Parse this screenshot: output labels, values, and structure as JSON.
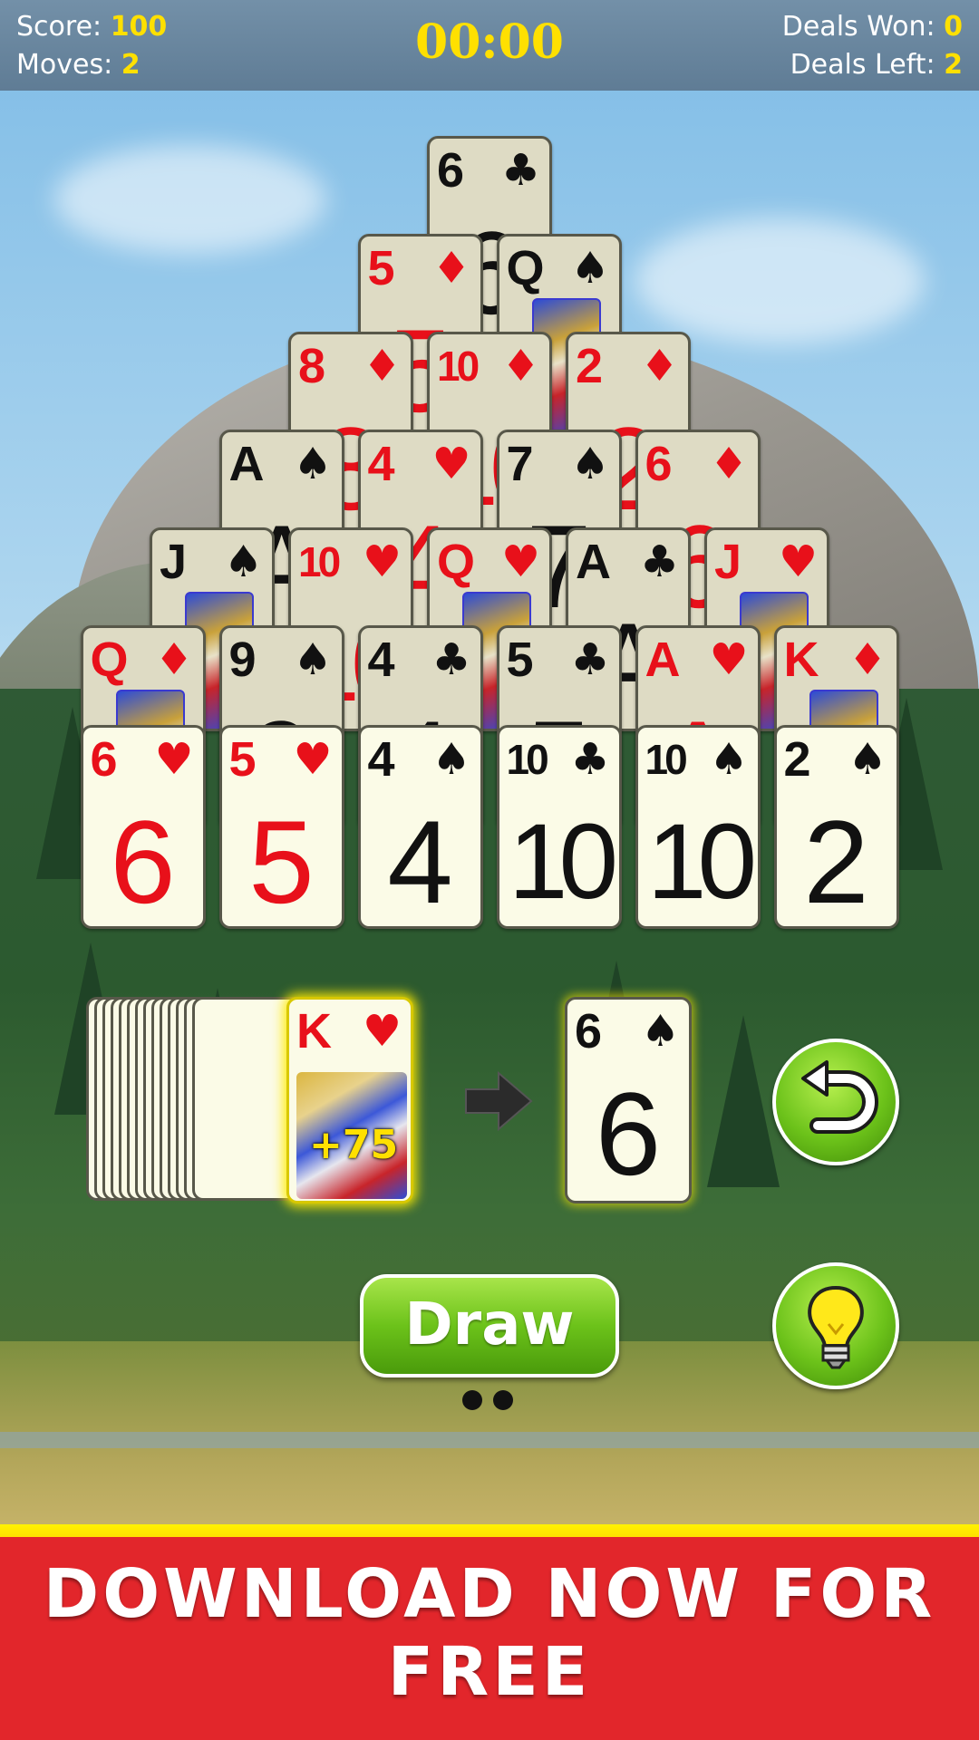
{
  "header": {
    "score_label": "Score:",
    "score_value": "100",
    "moves_label": "Moves:",
    "moves_value": "2",
    "timer": "00:00",
    "deals_won_label": "Deals Won:",
    "deals_won_value": "0",
    "deals_left_label": "Deals Left:",
    "deals_left_value": "2"
  },
  "pyramid": {
    "row1": [
      {
        "rank": "6",
        "suit": "♣",
        "color": "black"
      }
    ],
    "row2": [
      {
        "rank": "5",
        "suit": "♦",
        "color": "red"
      },
      {
        "rank": "Q",
        "suit": "♠",
        "color": "black"
      }
    ],
    "row3": [
      {
        "rank": "8",
        "suit": "♦",
        "color": "red"
      },
      {
        "rank": "10",
        "suit": "♦",
        "color": "red"
      },
      {
        "rank": "2",
        "suit": "♦",
        "color": "red"
      }
    ],
    "row4": [
      {
        "rank": "A",
        "suit": "♠",
        "color": "black"
      },
      {
        "rank": "4",
        "suit": "♥",
        "color": "red"
      },
      {
        "rank": "7",
        "suit": "♠",
        "color": "black"
      },
      {
        "rank": "6",
        "suit": "♦",
        "color": "red"
      }
    ],
    "row5": [
      {
        "rank": "J",
        "suit": "♠",
        "color": "black"
      },
      {
        "rank": "10",
        "suit": "♥",
        "color": "red"
      },
      {
        "rank": "Q",
        "suit": "♥",
        "color": "red"
      },
      {
        "rank": "A",
        "suit": "♣",
        "color": "black"
      },
      {
        "rank": "J",
        "suit": "♥",
        "color": "red"
      }
    ],
    "row6": [
      {
        "rank": "Q",
        "suit": "♦",
        "color": "red"
      },
      {
        "rank": "9",
        "suit": "♠",
        "color": "black"
      },
      {
        "rank": "4",
        "suit": "♣",
        "color": "black"
      },
      {
        "rank": "5",
        "suit": "♣",
        "color": "black"
      },
      {
        "rank": "A",
        "suit": "♥",
        "color": "red"
      },
      {
        "rank": "K",
        "suit": "♦",
        "color": "red"
      }
    ],
    "row7": [
      {
        "rank": "6",
        "suit": "♥",
        "color": "red"
      },
      {
        "rank": "5",
        "suit": "♥",
        "color": "red"
      },
      {
        "rank": "4",
        "suit": "♠",
        "color": "black"
      },
      {
        "rank": "10",
        "suit": "♣",
        "color": "black"
      },
      {
        "rank": "10",
        "suit": "♠",
        "color": "black"
      },
      {
        "rank": "2",
        "suit": "♠",
        "color": "black"
      }
    ]
  },
  "stock": {
    "top_rank": "K",
    "top_suit": "♥",
    "bonus": "+75"
  },
  "waste": {
    "rank": "6",
    "suit": "♠",
    "color": "black"
  },
  "buttons": {
    "draw_label": "Draw",
    "undo_icon": "undo-arrow-icon",
    "hint_icon": "lightbulb-icon"
  },
  "banner": {
    "text": "DOWNLOAD NOW FOR FREE"
  },
  "colors": {
    "red": "#e8101a",
    "black": "#111111",
    "header": "#6b869e",
    "banner": "#e2262b",
    "accent": "#ffe000"
  }
}
